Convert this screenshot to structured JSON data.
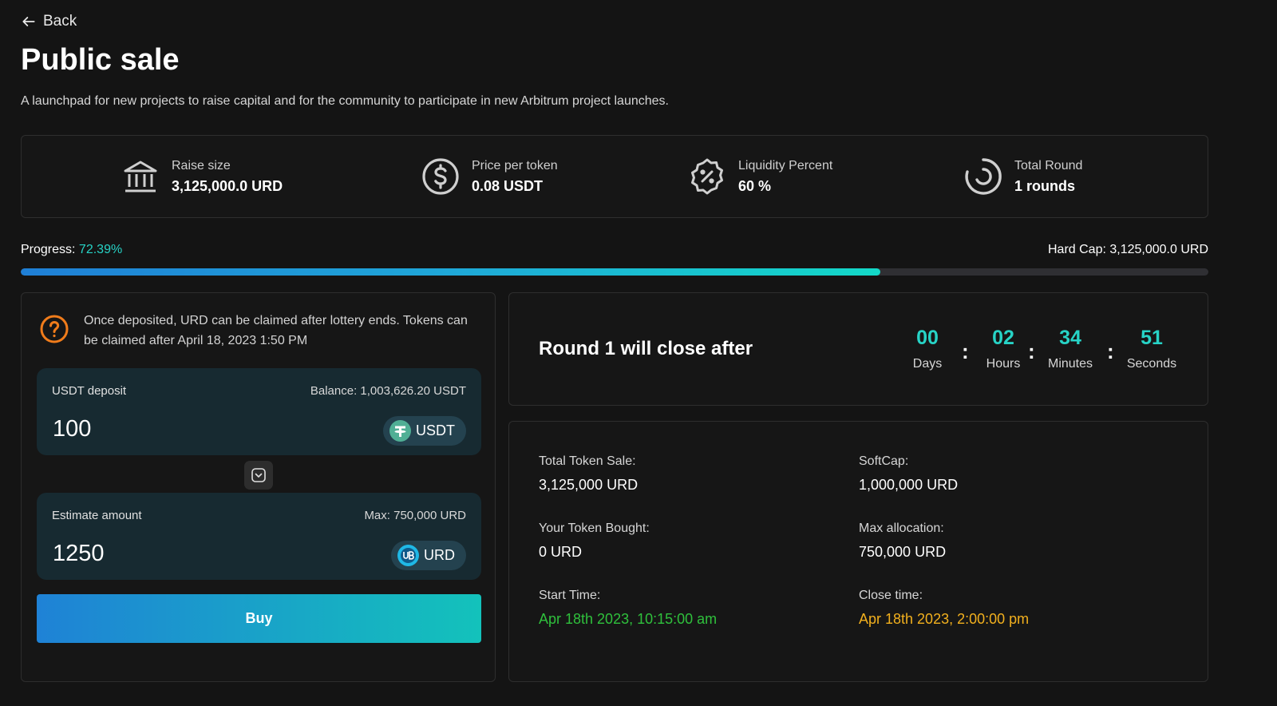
{
  "nav": {
    "back_label": "Back"
  },
  "header": {
    "title": "Public sale",
    "subtitle": "A launchpad for new projects to raise capital and for the community to participate in new Arbitrum project launches."
  },
  "stats": [
    {
      "icon": "bank-icon",
      "label": "Raise size",
      "value": "3,125,000.0 URD"
    },
    {
      "icon": "dollar-coin-icon",
      "label": "Price per token",
      "value": "0.08 USDT"
    },
    {
      "icon": "percent-badge-icon",
      "label": "Liquidity Percent",
      "value": "60 %"
    },
    {
      "icon": "round-progress-icon",
      "label": "Total Round",
      "value": "1 rounds"
    }
  ],
  "progress": {
    "label": "Progress:",
    "percent_text": "72.39%",
    "percent": 72.39,
    "hardcap_text": "Hard Cap: 3,125,000.0 URD"
  },
  "notice": {
    "text": "Once deposited, URD can be claimed after lottery ends. Tokens can be claimed after  April 18, 2023 1:50 PM"
  },
  "deposit": {
    "label": "USDT deposit",
    "balance": "Balance: 1,003,626.20 USDT",
    "value": "100",
    "token": "USDT"
  },
  "estimate": {
    "label": "Estimate amount",
    "max": "Max: 750,000  URD",
    "value": "1250",
    "token": "URD"
  },
  "buy_label": "Buy",
  "countdown": {
    "title": "Round 1 will close after",
    "units": [
      {
        "value": "00",
        "label": "Days"
      },
      {
        "value": "02",
        "label": "Hours"
      },
      {
        "value": "34",
        "label": "Minutes"
      },
      {
        "value": "51",
        "label": "Seconds"
      }
    ],
    "separator": ":"
  },
  "details": {
    "total_token_sale": {
      "label": "Total Token Sale:",
      "value": "3,125,000  URD"
    },
    "softcap": {
      "label": "SoftCap:",
      "value": "1,000,000  URD"
    },
    "your_token_bought": {
      "label": "Your Token Bought:",
      "value": "0  URD"
    },
    "max_allocation": {
      "label": "Max allocation:",
      "value": "750,000  URD"
    },
    "start_time": {
      "label": "Start Time:",
      "value": "Apr 18th 2023, 10:15:00 am"
    },
    "close_time": {
      "label": "Close time:",
      "value": "Apr 18th 2023, 2:00:00 pm"
    }
  },
  "colors": {
    "accent": "#27d3c6",
    "background": "#141414",
    "card_border": "#2e2e2e",
    "swap_box": "#172a31",
    "start_time": "#2fc03c",
    "close_time": "#f2b01e",
    "notice_icon": "#f07c1b"
  }
}
